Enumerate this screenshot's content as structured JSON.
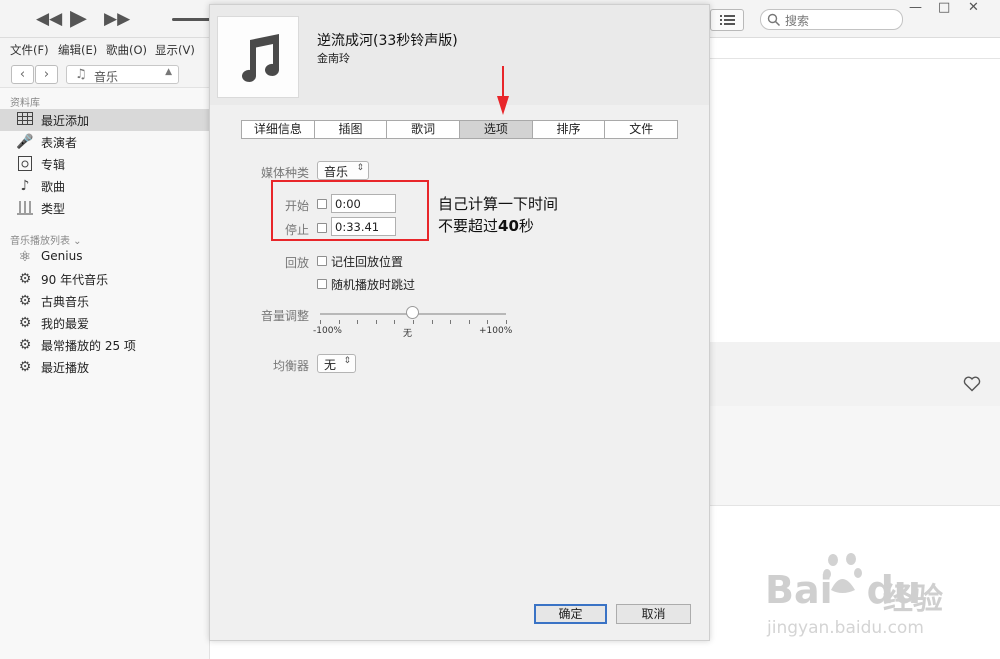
{
  "toolbar": {
    "search_placeholder": "搜索",
    "window_controls": [
      "—",
      "□",
      "✕"
    ],
    "icons": {
      "prev": "rewind-icon",
      "play": "play-icon",
      "next": "fast-forward-icon",
      "list": "list-view-icon",
      "search": "search-icon"
    }
  },
  "menu": [
    "文件(F)",
    "编辑(E)",
    "歌曲(O)",
    "显示(V)"
  ],
  "nav": {
    "media_type": "音乐"
  },
  "sidebar": {
    "library_title": "资料库",
    "library_items": [
      {
        "label": "最近添加",
        "icon": "grid-icon"
      },
      {
        "label": "表演者",
        "icon": "microphone-icon"
      },
      {
        "label": "专辑",
        "icon": "album-icon"
      },
      {
        "label": "歌曲",
        "icon": "music-note-icon"
      },
      {
        "label": "类型",
        "icon": "genre-icon"
      }
    ],
    "playlists_title": "音乐播放列表 ⌄",
    "playlists": [
      {
        "label": "Genius",
        "icon": "genius-atom-icon"
      },
      {
        "label": "90 年代音乐",
        "icon": "gear-icon"
      },
      {
        "label": "古典音乐",
        "icon": "gear-icon"
      },
      {
        "label": "我的最爱",
        "icon": "gear-icon"
      },
      {
        "label": "最常播放的 25 项",
        "icon": "gear-icon"
      },
      {
        "label": "最近播放",
        "icon": "gear-icon"
      }
    ]
  },
  "dialog": {
    "title": "逆流成河(33秒铃声版)",
    "artist": "金南玲",
    "tabs": [
      "详细信息",
      "插图",
      "歌词",
      "选项",
      "排序",
      "文件"
    ],
    "active_tab": "选项",
    "media_kind_label": "媒体种类",
    "media_kind_value": "音乐",
    "start_label": "开始",
    "start_value": "0:00",
    "stop_label": "停止",
    "stop_value": "0:33.41",
    "playback_label": "回放",
    "remember_position": "记住回放位置",
    "skip_shuffle": "随机播放时跳过",
    "volume_label": "音量调整",
    "volume_min": "-100%",
    "volume_mid": "无",
    "volume_max": "+100%",
    "volume_level": 0.5,
    "eq_label": "均衡器",
    "eq_value": "无",
    "ok": "确定",
    "cancel": "取消"
  },
  "annotation": {
    "line1": "自己计算一下时间",
    "line2_prefix": "不要超过",
    "line2_bold": "40",
    "line2_suffix": "秒",
    "color": "#e8262a"
  },
  "watermark": {
    "logo": "Bai",
    "logo2": "du",
    "cn": "经验",
    "url": "jingyan.baidu.com"
  }
}
